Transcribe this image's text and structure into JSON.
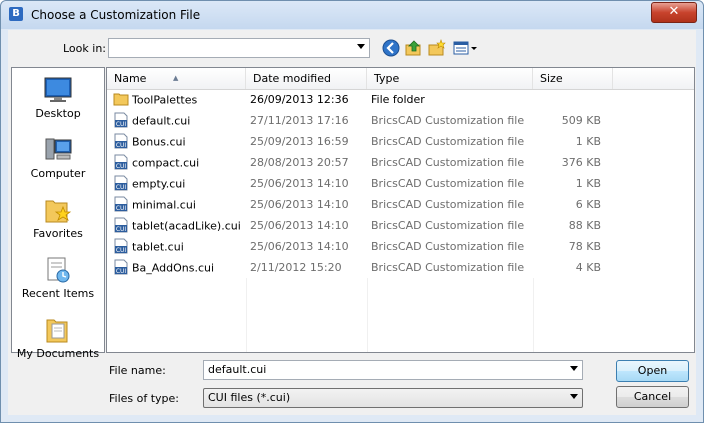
{
  "window": {
    "title": "Choose a Customization File",
    "close_label": "✕"
  },
  "toolbar": {
    "lookin_label": "Look in:",
    "lookin_value": "",
    "icons": [
      "back-icon",
      "up-folder-icon",
      "new-folder-icon",
      "view-menu-icon"
    ]
  },
  "places": [
    {
      "label": "Desktop",
      "icon": "desktop-icon"
    },
    {
      "label": "Computer",
      "icon": "computer-icon"
    },
    {
      "label": "Favorites",
      "icon": "favorites-icon"
    },
    {
      "label": "Recent Items",
      "icon": "recent-items-icon"
    },
    {
      "label": "My Documents",
      "icon": "my-documents-icon"
    }
  ],
  "columns": {
    "name": "Name",
    "date": "Date modified",
    "type": "Type",
    "size": "Size"
  },
  "files": [
    {
      "name": "ToolPalettes",
      "date": "26/09/2013 12:36",
      "type": "File folder",
      "size": "",
      "icon": "folder-icon"
    },
    {
      "name": "default.cui",
      "date": "27/11/2013 17:16",
      "type": "BricsCAD Customization file",
      "size": "509 KB",
      "icon": "cui-file-icon"
    },
    {
      "name": "Bonus.cui",
      "date": "25/09/2013 16:59",
      "type": "BricsCAD Customization file",
      "size": "1 KB",
      "icon": "cui-file-icon"
    },
    {
      "name": "compact.cui",
      "date": "28/08/2013 20:57",
      "type": "BricsCAD Customization file",
      "size": "376 KB",
      "icon": "cui-file-icon"
    },
    {
      "name": "empty.cui",
      "date": "25/06/2013 14:10",
      "type": "BricsCAD Customization file",
      "size": "1 KB",
      "icon": "cui-file-icon"
    },
    {
      "name": "minimal.cui",
      "date": "25/06/2013 14:10",
      "type": "BricsCAD Customization file",
      "size": "6 KB",
      "icon": "cui-file-icon"
    },
    {
      "name": "tablet(acadLike).cui",
      "date": "25/06/2013 14:10",
      "type": "BricsCAD Customization file",
      "size": "88 KB",
      "icon": "cui-file-icon"
    },
    {
      "name": "tablet.cui",
      "date": "25/06/2013 14:10",
      "type": "BricsCAD Customization file",
      "size": "78 KB",
      "icon": "cui-file-icon"
    },
    {
      "name": "Ba_AddOns.cui",
      "date": "2/11/2012 15:20",
      "type": "BricsCAD Customization file",
      "size": "4 KB",
      "icon": "cui-file-icon"
    }
  ],
  "bottom": {
    "filename_label": "File name:",
    "filename_value": "default.cui",
    "filetype_label": "Files of type:",
    "filetype_value": "CUI files (*.cui)",
    "open_label": "Open",
    "cancel_label": "Cancel"
  },
  "colors": {
    "titlebar": "#c5d8ef",
    "close": "#c8432d",
    "default_button": "#bee6fd",
    "folder": "#f3c85b",
    "cui_icon": "#2c5d9e"
  }
}
